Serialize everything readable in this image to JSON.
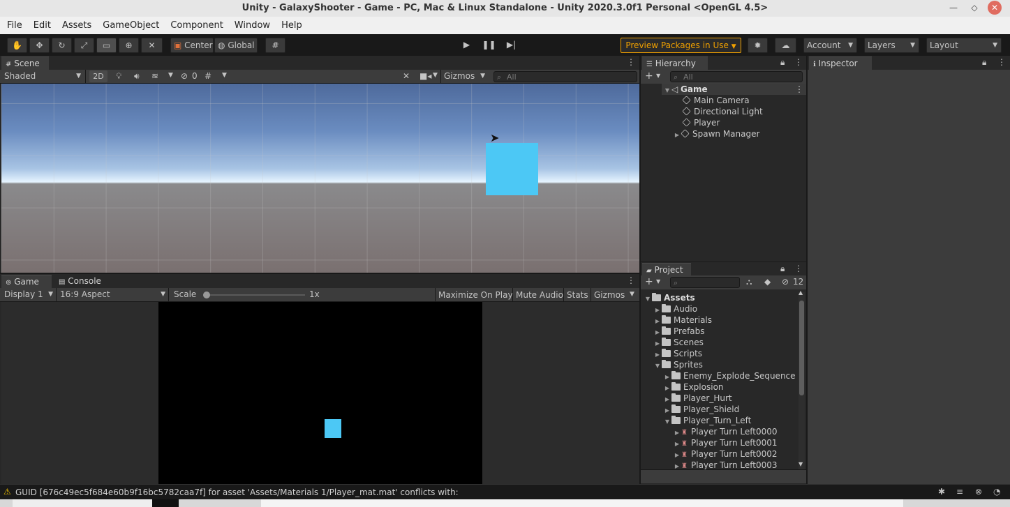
{
  "window": {
    "title": "Unity - GalaxyShooter - Game - PC, Mac & Linux Standalone - Unity 2020.3.0f1 Personal <OpenGL 4.5>"
  },
  "menu": [
    "File",
    "Edit",
    "Assets",
    "GameObject",
    "Component",
    "Window",
    "Help"
  ],
  "toolbar": {
    "pivot": "Center",
    "space": "Global",
    "preview_packages": "Preview Packages in Use",
    "account": "Account",
    "layers": "Layers",
    "layout": "Layout"
  },
  "scene": {
    "tab": "Scene",
    "shading": "Shaded",
    "mode2d": "2D",
    "hidden_count": "0",
    "gizmos": "Gizmos",
    "search_placeholder": "All"
  },
  "game": {
    "tab_game": "Game",
    "tab_console": "Console",
    "display": "Display 1",
    "aspect": "16:9 Aspect",
    "scale_label": "Scale",
    "scale_value": "1x",
    "scale_fraction": 0.0,
    "maximize": "Maximize On Play",
    "mute": "Mute Audio",
    "stats": "Stats",
    "gizmos": "Gizmos"
  },
  "hierarchy": {
    "tab": "Hierarchy",
    "search_placeholder": "All",
    "root": "Game",
    "items": [
      "Main Camera",
      "Directional Light",
      "Player",
      "Spawn Manager"
    ]
  },
  "inspector": {
    "tab": "Inspector"
  },
  "project": {
    "tab": "Project",
    "hidden_count": "12",
    "root": "Assets",
    "folders": [
      "Audio",
      "Materials",
      "Prefabs",
      "Scenes",
      "Scripts",
      "Sprites"
    ],
    "sprite_folders": [
      "Enemy_Explode_Sequence",
      "Explosion",
      "Player_Hurt",
      "Player_Shield",
      "Player_Turn_Left"
    ],
    "sprites": [
      "Player Turn Left0000",
      "Player Turn Left0001",
      "Player Turn Left0002",
      "Player Turn Left0003"
    ]
  },
  "status": {
    "message": "GUID [676c49ec5f684e60b9f16bc5782caa7f] for asset 'Assets/Materials 1/Player_mat.mat' conflicts with:"
  },
  "colors": {
    "player_cube": "#4cc8f5",
    "accent_orange": "#f0a000",
    "panel_bg": "#282828",
    "header_bg": "#3c3c3c"
  }
}
